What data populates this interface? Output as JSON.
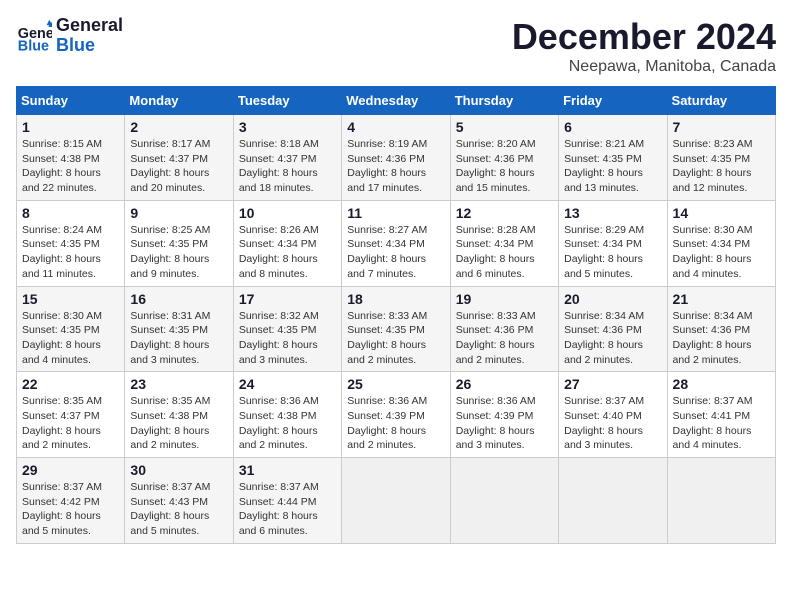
{
  "logo": {
    "line1": "General",
    "line2": "Blue"
  },
  "title": "December 2024",
  "location": "Neepawa, Manitoba, Canada",
  "days_of_week": [
    "Sunday",
    "Monday",
    "Tuesday",
    "Wednesday",
    "Thursday",
    "Friday",
    "Saturday"
  ],
  "weeks": [
    [
      {
        "day": "1",
        "sunrise": "8:15 AM",
        "sunset": "4:38 PM",
        "daylight": "8 hours and 22 minutes."
      },
      {
        "day": "2",
        "sunrise": "8:17 AM",
        "sunset": "4:37 PM",
        "daylight": "8 hours and 20 minutes."
      },
      {
        "day": "3",
        "sunrise": "8:18 AM",
        "sunset": "4:37 PM",
        "daylight": "8 hours and 18 minutes."
      },
      {
        "day": "4",
        "sunrise": "8:19 AM",
        "sunset": "4:36 PM",
        "daylight": "8 hours and 17 minutes."
      },
      {
        "day": "5",
        "sunrise": "8:20 AM",
        "sunset": "4:36 PM",
        "daylight": "8 hours and 15 minutes."
      },
      {
        "day": "6",
        "sunrise": "8:21 AM",
        "sunset": "4:35 PM",
        "daylight": "8 hours and 13 minutes."
      },
      {
        "day": "7",
        "sunrise": "8:23 AM",
        "sunset": "4:35 PM",
        "daylight": "8 hours and 12 minutes."
      }
    ],
    [
      {
        "day": "8",
        "sunrise": "8:24 AM",
        "sunset": "4:35 PM",
        "daylight": "8 hours and 11 minutes."
      },
      {
        "day": "9",
        "sunrise": "8:25 AM",
        "sunset": "4:35 PM",
        "daylight": "8 hours and 9 minutes."
      },
      {
        "day": "10",
        "sunrise": "8:26 AM",
        "sunset": "4:34 PM",
        "daylight": "8 hours and 8 minutes."
      },
      {
        "day": "11",
        "sunrise": "8:27 AM",
        "sunset": "4:34 PM",
        "daylight": "8 hours and 7 minutes."
      },
      {
        "day": "12",
        "sunrise": "8:28 AM",
        "sunset": "4:34 PM",
        "daylight": "8 hours and 6 minutes."
      },
      {
        "day": "13",
        "sunrise": "8:29 AM",
        "sunset": "4:34 PM",
        "daylight": "8 hours and 5 minutes."
      },
      {
        "day": "14",
        "sunrise": "8:30 AM",
        "sunset": "4:34 PM",
        "daylight": "8 hours and 4 minutes."
      }
    ],
    [
      {
        "day": "15",
        "sunrise": "8:30 AM",
        "sunset": "4:35 PM",
        "daylight": "8 hours and 4 minutes."
      },
      {
        "day": "16",
        "sunrise": "8:31 AM",
        "sunset": "4:35 PM",
        "daylight": "8 hours and 3 minutes."
      },
      {
        "day": "17",
        "sunrise": "8:32 AM",
        "sunset": "4:35 PM",
        "daylight": "8 hours and 3 minutes."
      },
      {
        "day": "18",
        "sunrise": "8:33 AM",
        "sunset": "4:35 PM",
        "daylight": "8 hours and 2 minutes."
      },
      {
        "day": "19",
        "sunrise": "8:33 AM",
        "sunset": "4:36 PM",
        "daylight": "8 hours and 2 minutes."
      },
      {
        "day": "20",
        "sunrise": "8:34 AM",
        "sunset": "4:36 PM",
        "daylight": "8 hours and 2 minutes."
      },
      {
        "day": "21",
        "sunrise": "8:34 AM",
        "sunset": "4:36 PM",
        "daylight": "8 hours and 2 minutes."
      }
    ],
    [
      {
        "day": "22",
        "sunrise": "8:35 AM",
        "sunset": "4:37 PM",
        "daylight": "8 hours and 2 minutes."
      },
      {
        "day": "23",
        "sunrise": "8:35 AM",
        "sunset": "4:38 PM",
        "daylight": "8 hours and 2 minutes."
      },
      {
        "day": "24",
        "sunrise": "8:36 AM",
        "sunset": "4:38 PM",
        "daylight": "8 hours and 2 minutes."
      },
      {
        "day": "25",
        "sunrise": "8:36 AM",
        "sunset": "4:39 PM",
        "daylight": "8 hours and 2 minutes."
      },
      {
        "day": "26",
        "sunrise": "8:36 AM",
        "sunset": "4:39 PM",
        "daylight": "8 hours and 3 minutes."
      },
      {
        "day": "27",
        "sunrise": "8:37 AM",
        "sunset": "4:40 PM",
        "daylight": "8 hours and 3 minutes."
      },
      {
        "day": "28",
        "sunrise": "8:37 AM",
        "sunset": "4:41 PM",
        "daylight": "8 hours and 4 minutes."
      }
    ],
    [
      {
        "day": "29",
        "sunrise": "8:37 AM",
        "sunset": "4:42 PM",
        "daylight": "8 hours and 5 minutes."
      },
      {
        "day": "30",
        "sunrise": "8:37 AM",
        "sunset": "4:43 PM",
        "daylight": "8 hours and 5 minutes."
      },
      {
        "day": "31",
        "sunrise": "8:37 AM",
        "sunset": "4:44 PM",
        "daylight": "8 hours and 6 minutes."
      },
      null,
      null,
      null,
      null
    ]
  ],
  "labels": {
    "sunrise": "Sunrise:",
    "sunset": "Sunset:",
    "daylight": "Daylight:"
  }
}
